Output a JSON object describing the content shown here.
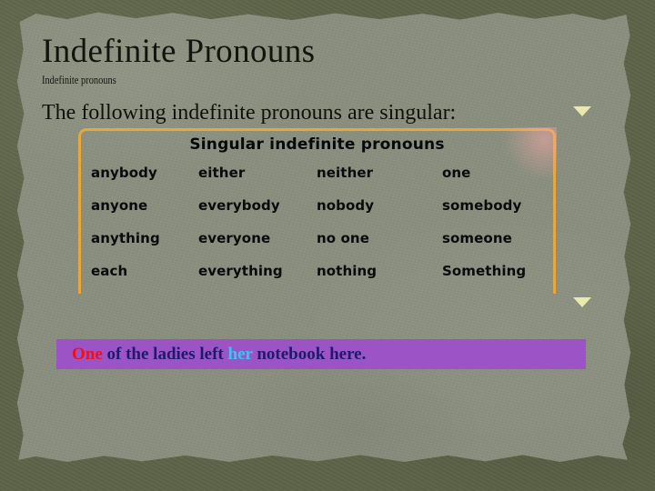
{
  "slide": {
    "title": "Indefinite Pronouns",
    "subtitle": "Indefinite pronouns",
    "lead_text": "The following indefinite pronouns are singular:"
  },
  "table": {
    "header": "Singular indefinite pronouns",
    "border_color": "#e9a63c",
    "rows": [
      [
        "anybody",
        "either",
        "neither",
        "one"
      ],
      [
        "anyone",
        "everybody",
        "nobody",
        "somebody"
      ],
      [
        "anything",
        "everyone",
        "no one",
        "someone"
      ],
      [
        "each",
        "everything",
        "nothing",
        "Something"
      ]
    ]
  },
  "markers": {
    "top_triangle": "triangle-down",
    "bottom_triangle": "triangle-down",
    "color": "#e9e9ad"
  },
  "example": {
    "background_color": "#9b53c6",
    "segments": [
      {
        "text": "One",
        "color": "#f40d14"
      },
      {
        "text": " of the ladies left ",
        "color": "#201a6e"
      },
      {
        "text": "her",
        "color": "#38c6f4"
      },
      {
        "text": " notebook here.",
        "color": "#201a6e"
      }
    ],
    "full_text": "One of the ladies left her notebook here."
  },
  "theme": {
    "frame_color": "#5e6448",
    "paper_color": "#8b907f"
  }
}
